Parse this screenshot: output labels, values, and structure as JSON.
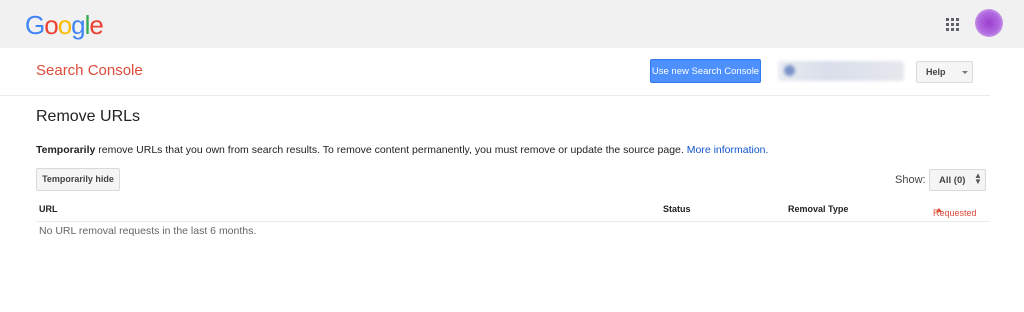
{
  "google_logo": {
    "letters": [
      {
        "ch": "G",
        "color": "#4285F4"
      },
      {
        "ch": "o",
        "color": "#EA4335"
      },
      {
        "ch": "o",
        "color": "#FBBC05"
      },
      {
        "ch": "g",
        "color": "#4285F4"
      },
      {
        "ch": "l",
        "color": "#34A853"
      },
      {
        "ch": "e",
        "color": "#EA4335"
      }
    ]
  },
  "header": {
    "product": "Search Console",
    "new_console_button": "Use new Search Console",
    "help_button": "Help"
  },
  "page": {
    "title": "Remove URLs",
    "desc_bold": "Temporarily",
    "desc_text": " remove URLs that you own from search results. To remove content permanently, you must remove or update the source page. ",
    "desc_link": "More information."
  },
  "toolbar": {
    "temp_hide_button": "Temporarily hide",
    "show_label": "Show:",
    "show_value": "All (0)"
  },
  "table": {
    "columns": [
      "URL",
      "Status",
      "Removal Type",
      "Requested"
    ],
    "empty_message": "No URL removal requests in the last 6 months."
  },
  "colors": {
    "brand_red": "#dd4b39",
    "primary_button": "#4d90fe",
    "link": "#1155cc"
  }
}
